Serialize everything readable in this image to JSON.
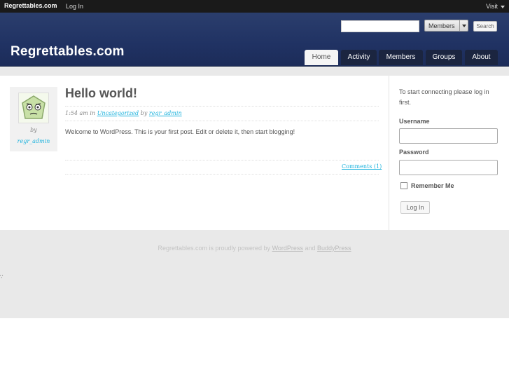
{
  "adminbar": {
    "logo": "Regrettables.com",
    "login": "Log In",
    "visit": "Visit"
  },
  "header": {
    "site_title": "Regrettables.com",
    "search": {
      "placeholder": "",
      "select_value": "Members",
      "button": "Search"
    },
    "nav": [
      "Home",
      "Activity",
      "Members",
      "Groups",
      "About"
    ],
    "active_tab": "Home"
  },
  "post": {
    "title": "Hello world!",
    "time": "1:54 am",
    "in_word": "in",
    "category": "Uncategorized",
    "by_word": "by",
    "author": "regr_admin",
    "body": "Welcome to WordPress. This is your first post. Edit or delete it, then start blogging!",
    "comments": "Comments (1)"
  },
  "author_box": {
    "by": "by",
    "name": "regr_admin"
  },
  "sidebar": {
    "intro": "To start connecting please log in first.",
    "username_label": "Username",
    "password_label": "Password",
    "remember_label": "Remember Me",
    "login_button": "Log In"
  },
  "footer": {
    "prefix": "Regrettables.com is proudly powered by",
    "link1": "WordPress",
    "and": "and",
    "link2": "BuddyPress"
  },
  "colors": {
    "header": "#203263",
    "link": "#1fb3dd",
    "nav_tab": "#1b2540"
  }
}
